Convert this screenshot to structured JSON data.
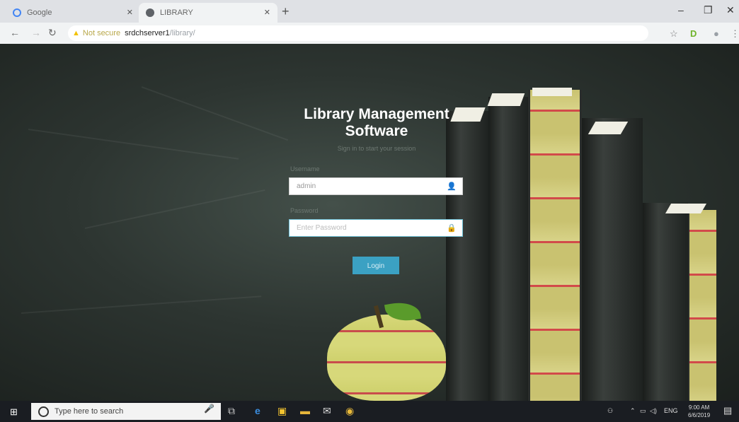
{
  "browser": {
    "tabs": [
      {
        "title": "Google",
        "favicon_color": "#4285f4"
      },
      {
        "title": "LIBRARY",
        "favicon_color": "#5f6368"
      }
    ],
    "new_tab": "+",
    "window_controls": {
      "minimize": "–",
      "maximize": "❐",
      "close": "✕"
    },
    "address": {
      "warning": "Not secure",
      "host": "srdchserver1",
      "path": "/library/"
    }
  },
  "login": {
    "title_line1": "Library Management",
    "title_line2": "Software",
    "subtitle": "Sign in to start your session",
    "username_label": "Username",
    "username_value": "admin",
    "password_label": "Password",
    "password_placeholder": "Enter Password",
    "login_button": "Login"
  },
  "taskbar": {
    "search_placeholder": "Type here to search",
    "language": "ENG",
    "time": "9:00 AM",
    "date": "6/6/2019"
  },
  "colors": {
    "accent": "#3ba1c3",
    "chalkboard": "#2d3531"
  }
}
